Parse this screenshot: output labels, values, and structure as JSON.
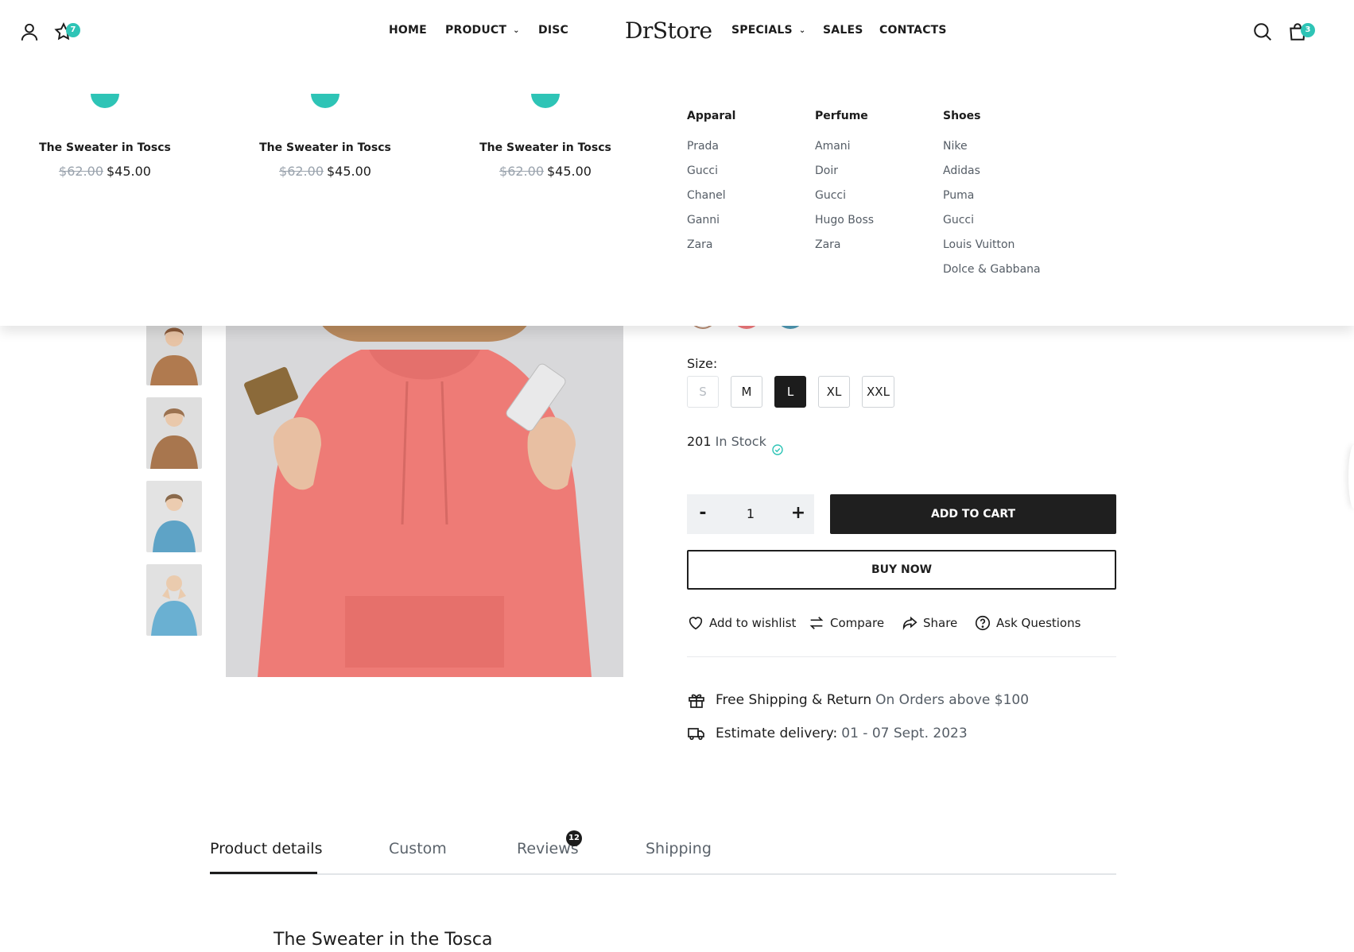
{
  "header": {
    "logo": "DrStore",
    "wishlist_count": "7",
    "cart_count": "3",
    "nav": {
      "home": "HOME",
      "product": "PRODUCT",
      "disc": "DISC",
      "specials": "SPECIALS",
      "sales": "SALES",
      "contacts": "CONTACTS"
    },
    "icons": [
      "user-icon",
      "star-icon",
      "search-icon",
      "bag-icon"
    ]
  },
  "mega_menu": {
    "products": [
      {
        "title": "The Sweater in Toscs",
        "old_price": "$62.00",
        "price": "$45.00"
      },
      {
        "title": "The Sweater in Toscs",
        "old_price": "$62.00",
        "price": "$45.00"
      },
      {
        "title": "The Sweater in Toscs",
        "old_price": "$62.00",
        "price": "$45.00"
      }
    ],
    "columns": [
      {
        "heading": "Apparal",
        "links": [
          "Prada",
          "Gucci",
          "Chanel",
          "Ganni",
          "Zara"
        ]
      },
      {
        "heading": "Perfume",
        "links": [
          "Amani",
          "Doir",
          "Gucci",
          "Hugo Boss",
          "Zara"
        ]
      },
      {
        "heading": "Shoes",
        "links": [
          "Nike",
          "Adidas",
          "Puma",
          "Gucci",
          "Louis Vuitton",
          "Dolce & Gabbana"
        ]
      }
    ]
  },
  "product": {
    "size_label": "Size:",
    "sizes": [
      {
        "label": "S",
        "state": "disabled"
      },
      {
        "label": "M",
        "state": "normal"
      },
      {
        "label": "L",
        "state": "active"
      },
      {
        "label": "XL",
        "state": "normal"
      },
      {
        "label": "XXL",
        "state": "normal"
      }
    ],
    "stock_count": "201",
    "stock_text": "In Stock",
    "qty_minus": "-",
    "qty_value": "1",
    "qty_plus": "+",
    "add_to_cart": "ADD TO CART",
    "buy_now": "BUY NOW",
    "actions": {
      "wishlist": "Add to wishlist",
      "compare": "Compare",
      "share": "Share",
      "ask": "Ask Questions"
    },
    "shipping": {
      "free_label": "Free Shipping & Return",
      "free_note": "On Orders above $100",
      "delivery_label": "Estimate delivery:",
      "delivery_dates": "01 - 07 Sept. 2023"
    },
    "swatch_colors": [
      "#b98d74",
      "#f07a7d",
      "#4f9ab5"
    ]
  },
  "tabs": {
    "items": [
      "Product details",
      "Custom",
      "Reviews",
      "Shipping"
    ],
    "reviews_count": "12",
    "active": "Product details"
  },
  "section_title": "The Sweater in the Tosca",
  "colors": {
    "accent": "#2ec4b6",
    "dark": "#1f1f1f",
    "muted": "#555d66"
  }
}
